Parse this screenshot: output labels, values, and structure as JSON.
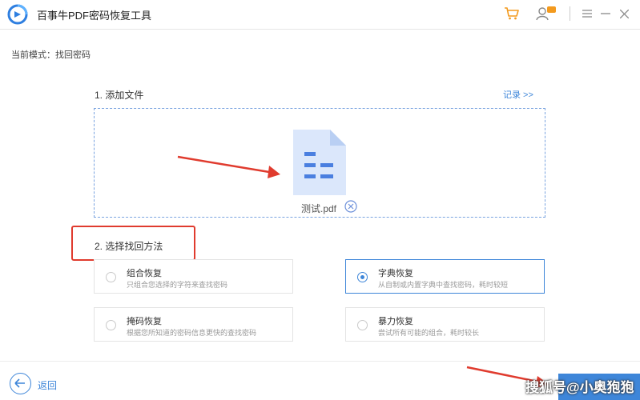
{
  "window": {
    "title": "百事牛PDF密码恢复工具",
    "controls": [
      "cart-icon",
      "user-icon",
      "menu-icon",
      "minimize-icon",
      "close-icon"
    ]
  },
  "mode_label": "当前模式：找回密码",
  "step1": {
    "title": "1. 添加文件",
    "record_link": "记录 >>",
    "file_name": "测试.pdf"
  },
  "step2": {
    "title": "2. 选择找回方法",
    "options": [
      {
        "title": "组合恢复",
        "desc": "只组合您选择的字符来查找密码",
        "selected": false
      },
      {
        "title": "字典恢复",
        "desc": "从自制或内置字典中查找密码，耗时较短",
        "selected": true
      },
      {
        "title": "掩码恢复",
        "desc": "根据您所知道的密码信息更快的查找密码",
        "selected": false
      },
      {
        "title": "暴力恢复",
        "desc": "尝试所有可能的组合，耗时较长",
        "selected": false
      }
    ]
  },
  "footer": {
    "back_label": "返回"
  },
  "watermark": "搜狐号@小奥狍狍",
  "colors": {
    "accent": "#3e86d9",
    "annotation_red": "#e03b2e",
    "cart_orange": "#f39a1e"
  }
}
